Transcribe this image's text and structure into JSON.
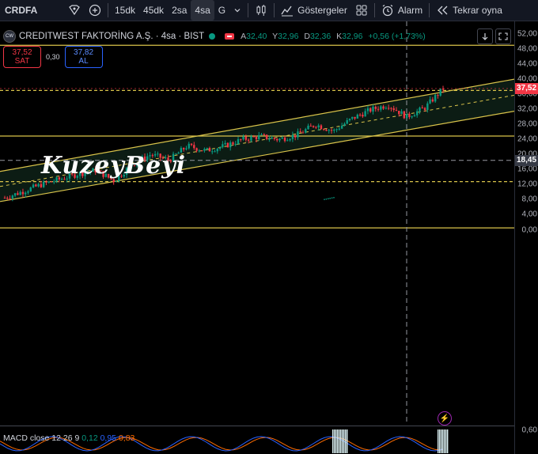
{
  "toolbar": {
    "symbol": "CRDFA",
    "intervals": [
      "15dk",
      "45dk",
      "2sa",
      "4sa",
      "G"
    ],
    "active_interval": "4sa",
    "indicators_label": "Göstergeler",
    "alert_label": "Alarm",
    "replay_label": "Tekrar oyna"
  },
  "legend": {
    "logo_text": "CW",
    "title": "CREDITWEST FAKTORİNG A.Ş. · 4sa · BIST",
    "open_label": "A",
    "open": "32,40",
    "high_label": "Y",
    "high": "32,96",
    "low_label": "D",
    "low": "32,36",
    "close_label": "K",
    "close": "32,96",
    "change": "+0,56 (+1,73%)"
  },
  "trade": {
    "sell_price": "37,52",
    "sell_label": "SAT",
    "spread": "0,30",
    "buy_price": "37,82",
    "buy_label": "AL"
  },
  "watermark": "KuzeyBeyi",
  "axis": {
    "ticks": [
      "52,00",
      "48,00",
      "44,00",
      "40,00",
      "36,00",
      "32,00",
      "28,00",
      "24,00",
      "20,00",
      "16,00",
      "12,00",
      "8,00",
      "4,00",
      "0,00"
    ],
    "last_price": "37,52",
    "crosshair_price": "18,45",
    "macd_tick": "0,60"
  },
  "macd": {
    "label": "MACD close 12 26 9",
    "histogram": "0,12",
    "macd": "0,95",
    "signal": "0,83"
  },
  "chart_data": {
    "type": "candlestick",
    "y_axis_range": [
      0,
      52
    ],
    "price_bars_approx": [
      {
        "i": 0,
        "c": 8.5
      },
      {
        "i": 1,
        "c": 10.2
      },
      {
        "i": 2,
        "c": 12.0
      },
      {
        "i": 3,
        "c": 13.4
      },
      {
        "i": 4,
        "c": 14.8
      },
      {
        "i": 5,
        "c": 15.8
      },
      {
        "i": 6,
        "c": 13.0
      },
      {
        "i": 7,
        "c": 17.5
      },
      {
        "i": 8,
        "c": 20.0
      },
      {
        "i": 9,
        "c": 18.5
      },
      {
        "i": 10,
        "c": 22.3
      },
      {
        "i": 11,
        "c": 21.0
      },
      {
        "i": 12,
        "c": 22.2
      },
      {
        "i": 13,
        "c": 24.0
      },
      {
        "i": 14,
        "c": 24.8
      },
      {
        "i": 15,
        "c": 24.0
      },
      {
        "i": 16,
        "c": 25.2
      },
      {
        "i": 17,
        "c": 28.0
      },
      {
        "i": 18,
        "c": 26.2
      },
      {
        "i": 19,
        "c": 29.5
      },
      {
        "i": 20,
        "c": 31.8
      },
      {
        "i": 21,
        "c": 33.2
      },
      {
        "i": 22,
        "c": 30.0
      },
      {
        "i": 23,
        "c": 32.4
      },
      {
        "i": 24,
        "c": 37.5
      }
    ],
    "horizontal_levels": [
      49.0,
      37.0,
      24.9,
      12.8,
      0.5
    ],
    "channel_upper_approx": {
      "from": 15.5,
      "to": 40.0
    },
    "channel_lower_approx": {
      "from": 7.5,
      "to": 31.5
    },
    "colors": {
      "up": "#089981",
      "down": "#f23645",
      "levels": "#d9c34a",
      "last_price": "#f23645"
    }
  }
}
